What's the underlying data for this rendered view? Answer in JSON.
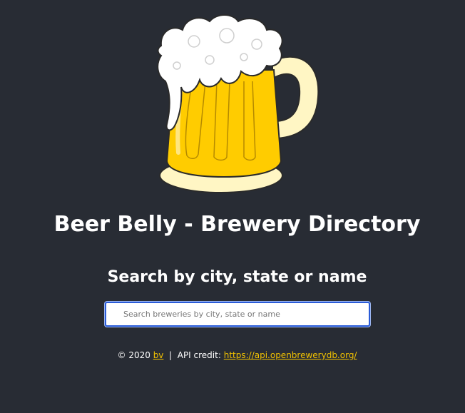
{
  "header": {
    "title": "Beer Belly - Brewery Directory",
    "logo_icon": "beer-mug-icon"
  },
  "search": {
    "heading": "Search by city, state or name",
    "placeholder": "Search breweries by city, state or name",
    "value": ""
  },
  "footer": {
    "copyright": "© 2020",
    "author_link": "bv",
    "separator": "|",
    "credit_label": "API credit:",
    "api_link": "https://api.openbrewerydb.org/"
  },
  "colors": {
    "background": "#282c34",
    "text": "#ffffff",
    "link": "#f2c200",
    "input_border": "#2a5bd7",
    "beer": "#ffcc00",
    "foam": "#ffffff",
    "glass": "#fff3b0"
  }
}
